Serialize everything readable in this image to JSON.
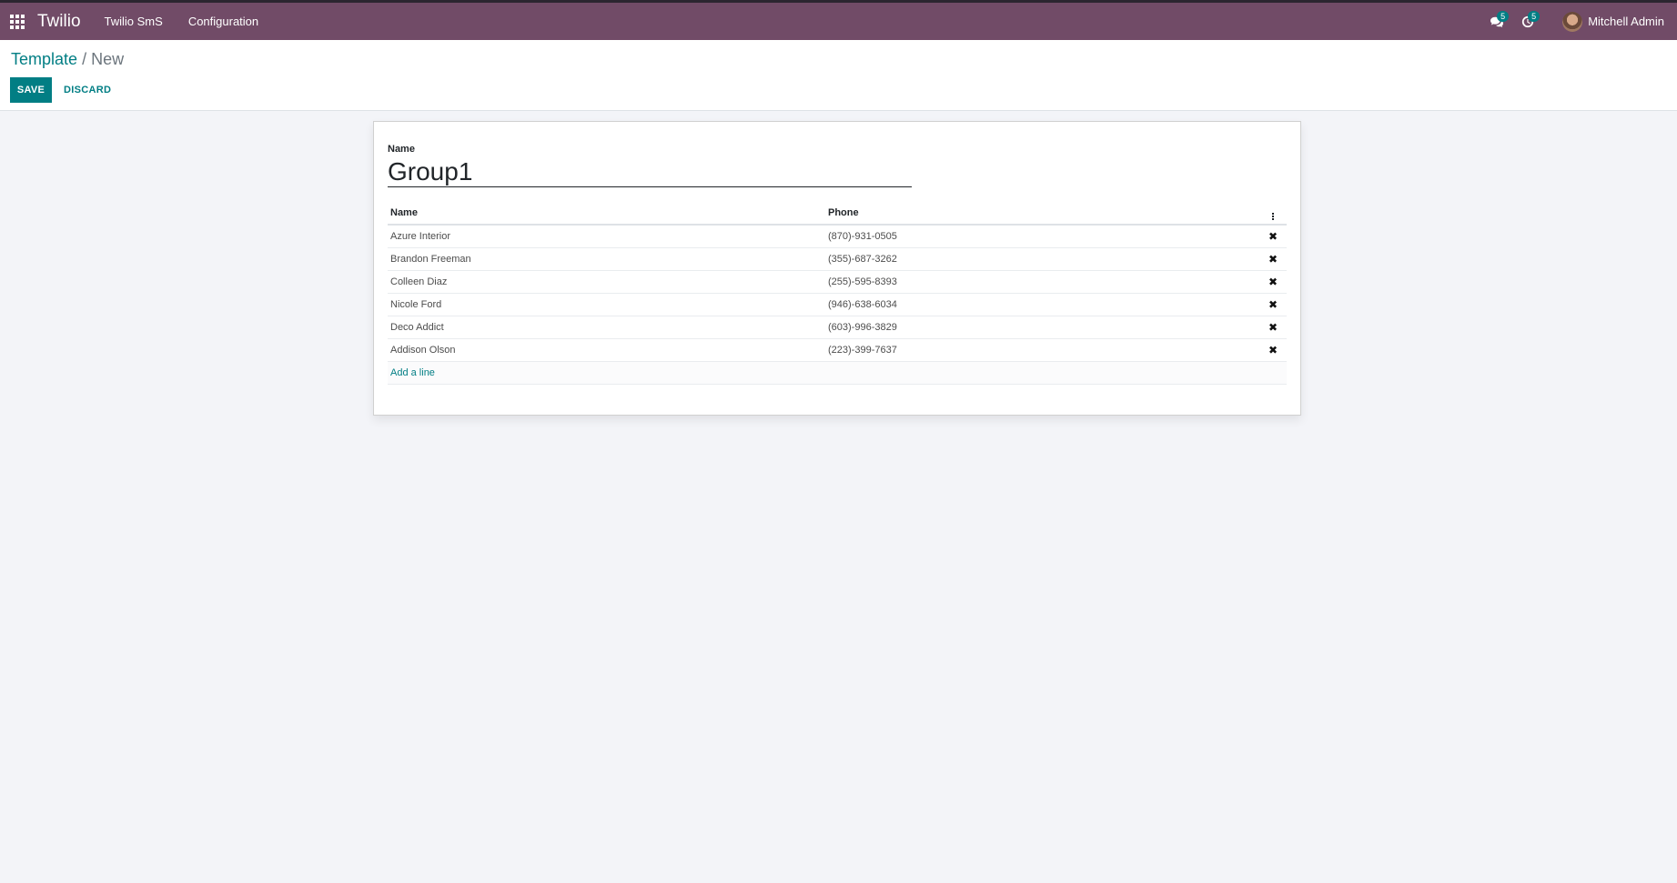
{
  "navbar": {
    "brand": "Twilio",
    "menu": [
      "Twilio SmS",
      "Configuration"
    ],
    "messages_count": "5",
    "activities_count": "5",
    "user_name": "Mitchell Admin"
  },
  "breadcrumb": {
    "parent": "Template",
    "separator": "/",
    "current": "New"
  },
  "buttons": {
    "save": "SAVE",
    "discard": "DISCARD"
  },
  "form": {
    "name_label": "Name",
    "name_value": "Group1",
    "table": {
      "headers": [
        "Name",
        "Phone"
      ],
      "rows": [
        {
          "name": "Azure Interior",
          "phone": "(870)-931-0505"
        },
        {
          "name": "Brandon Freeman",
          "phone": "(355)-687-3262"
        },
        {
          "name": "Colleen Diaz",
          "phone": "(255)-595-8393"
        },
        {
          "name": "Nicole Ford",
          "phone": "(946)-638-6034"
        },
        {
          "name": "Deco Addict",
          "phone": "(603)-996-3829"
        },
        {
          "name": "Addison Olson",
          "phone": "(223)-399-7637"
        }
      ],
      "add_line": "Add a line",
      "delete_glyph": "✖"
    }
  },
  "colors": {
    "navbar": "#714b67",
    "accent": "#017e84",
    "background": "#f3f4f8"
  }
}
